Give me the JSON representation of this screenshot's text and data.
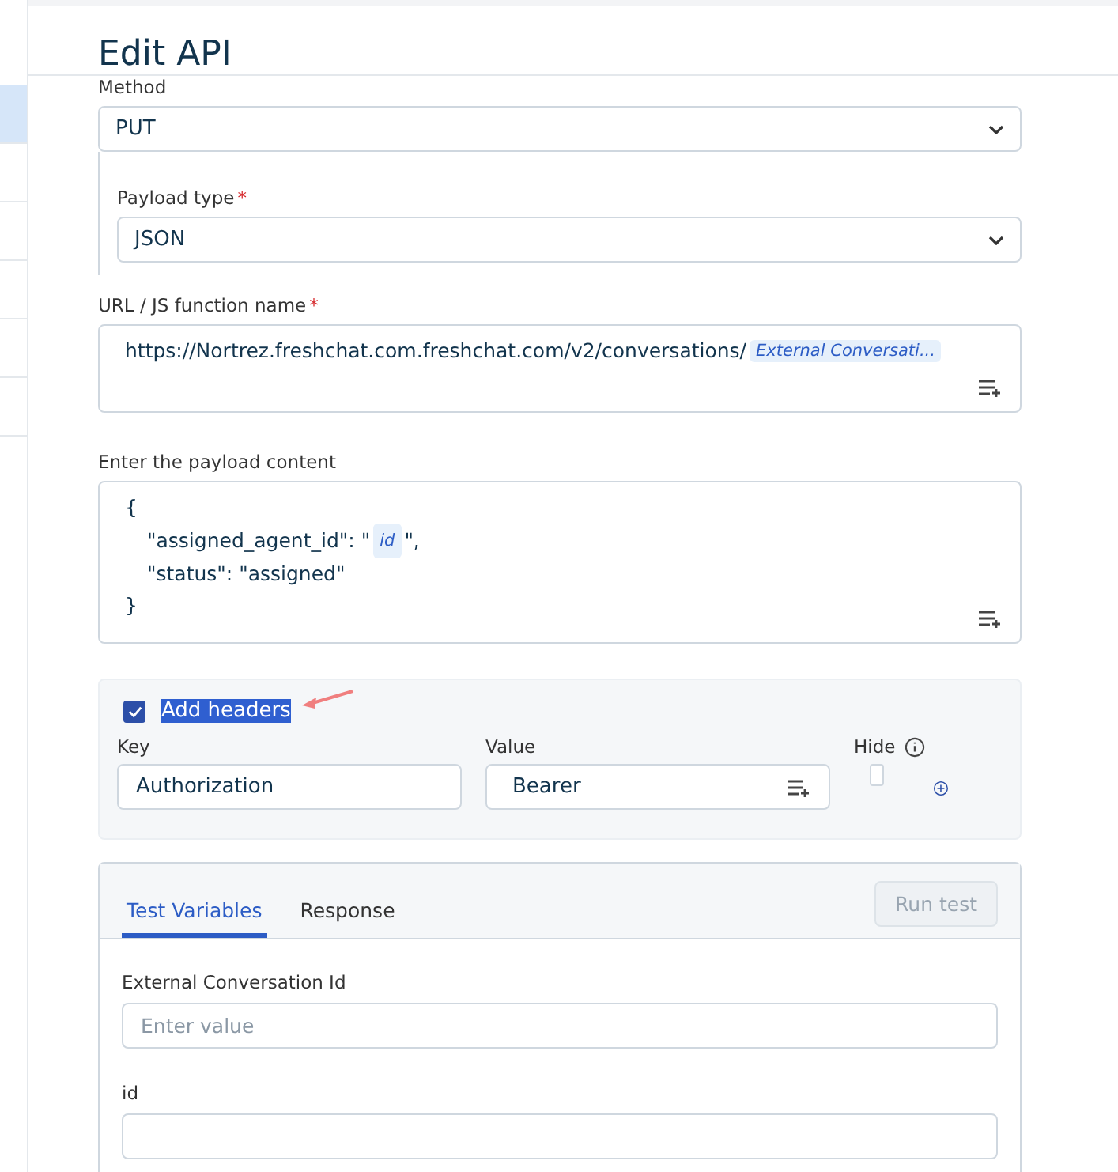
{
  "sidebar": {
    "items": [
      {
        "selected": true
      },
      {
        "selected": false
      },
      {
        "selected": false
      },
      {
        "selected": false
      },
      {
        "selected": false
      },
      {
        "selected": false
      }
    ]
  },
  "title": "Edit API",
  "method": {
    "label": "Method",
    "value": "PUT"
  },
  "payload_type": {
    "label": "Payload type",
    "required_mark": "*",
    "value": "JSON"
  },
  "url": {
    "label": "URL / JS function name",
    "required_mark": "*",
    "segments": [
      {
        "kind": "text",
        "text": "https://Nortrez.freshchat.com.freshchat.com/v2/conversations/"
      },
      {
        "kind": "token",
        "text": "External Conversati..."
      }
    ]
  },
  "payload": {
    "label": "Enter the payload content",
    "lines": [
      [
        {
          "kind": "text",
          "text": "{"
        }
      ],
      [
        {
          "kind": "text",
          "text": "\"assigned_agent_id\": \""
        },
        {
          "kind": "token",
          "text": "id"
        },
        {
          "kind": "text",
          "text": "\","
        }
      ],
      [
        {
          "kind": "text",
          "text": "\"status\": \"assigned\""
        }
      ],
      [
        {
          "kind": "text",
          "text": "}"
        }
      ]
    ]
  },
  "headers": {
    "checked": true,
    "label": "Add headers",
    "highlighted": true,
    "columns": [
      "Key",
      "Value",
      "Hide"
    ],
    "rows": [
      {
        "key": "Authorization",
        "value": "Bearer",
        "hide": false
      }
    ]
  },
  "test": {
    "tabs": [
      {
        "label": "Test Variables",
        "selected": true
      },
      {
        "label": "Response",
        "selected": false
      }
    ],
    "run_button": {
      "label": "Run test",
      "disabled": true
    },
    "fields": [
      {
        "label": "External Conversation Id",
        "placeholder": "Enter value"
      },
      {
        "label": "id"
      }
    ]
  }
}
